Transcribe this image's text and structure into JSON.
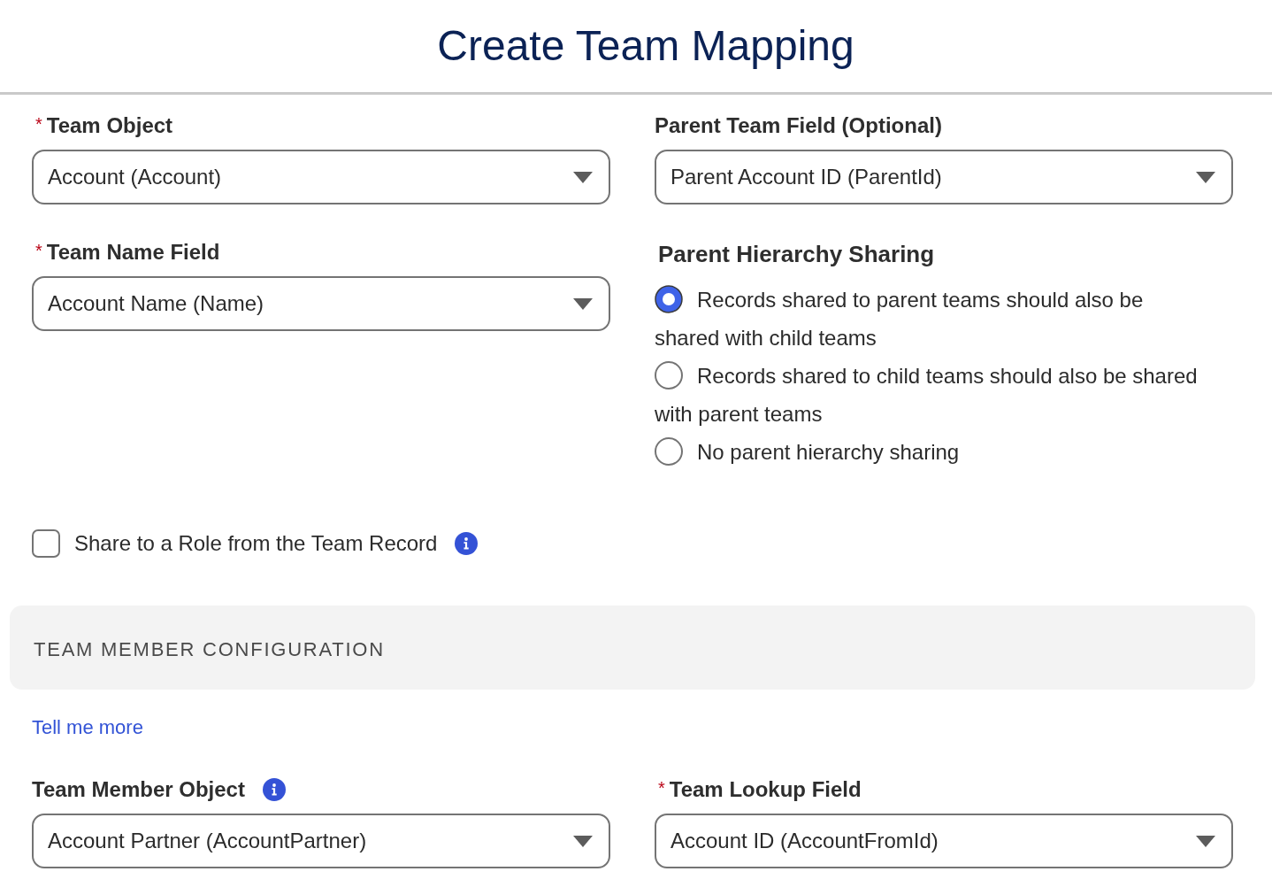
{
  "title": "Create Team Mapping",
  "left_column": [
    {
      "label": "Team Object",
      "required_mark": "*",
      "value": "Account (Account)"
    },
    {
      "label": "Team Name Field",
      "required_mark": "*",
      "value": "Account Name (Name)"
    }
  ],
  "right_column": {
    "field": {
      "label": "Parent Team Field (Optional)",
      "value": "Parent Account ID (ParentId)"
    },
    "hierarchy_sharing": {
      "title": "Parent Hierarchy Sharing",
      "options": [
        {
          "label": "Records shared to parent teams should also be shared with child teams",
          "selected": true
        },
        {
          "label": "Records shared to child teams should also be shared with parent teams",
          "selected": false
        },
        {
          "label": "No parent hierarchy sharing",
          "selected": false
        }
      ]
    }
  },
  "share_to_role": {
    "label": "Share to a Role from the Team Record",
    "checked": false,
    "info_icon": true
  },
  "section": {
    "title": "TEAM MEMBER CONFIGURATION"
  },
  "help_link": "Tell me more",
  "member_fields": [
    {
      "label": "Team Member Object",
      "info_icon": true,
      "value": "Account Partner (AccountPartner)"
    },
    {
      "label": "Team Lookup Field",
      "required_mark": "*",
      "value": "Account ID (AccountFromId)"
    }
  ]
}
